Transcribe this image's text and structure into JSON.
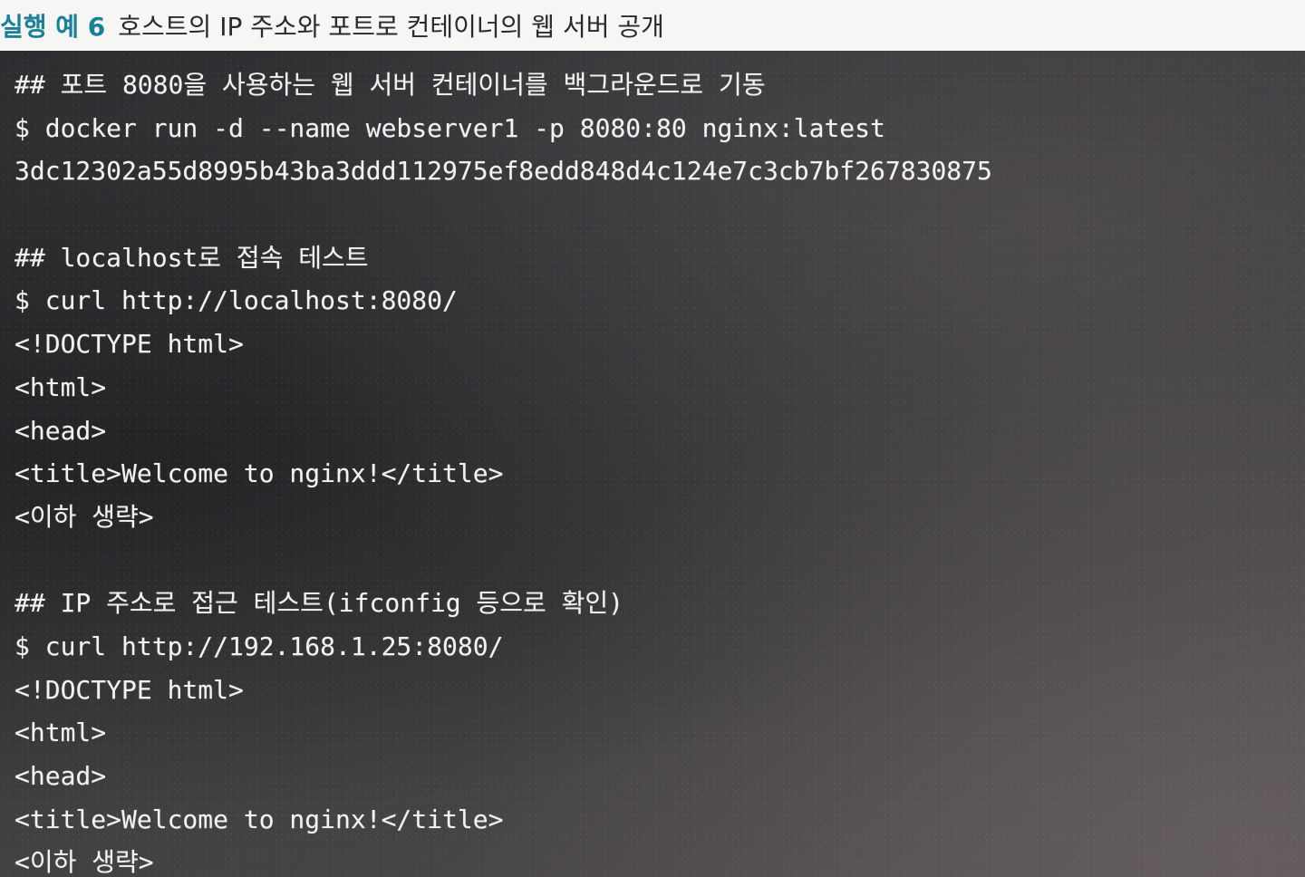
{
  "caption": {
    "label": "실행 예 6",
    "text": "호스트의 IP 주소와 포트로 컨테이너의 웹 서버 공개"
  },
  "terminal": {
    "lines": [
      "## 포트 8080을 사용하는 웹 서버 컨테이너를 백그라운드로 기동",
      "$ docker run -d --name webserver1 -p 8080:80 nginx:latest",
      "3dc12302a55d8995b43ba3ddd112975ef8edd848d4c124e7c3cb7bf267830875",
      "",
      "## localhost로 접속 테스트",
      "$ curl http://localhost:8080/",
      "<!DOCTYPE html>",
      "<html>",
      "<head>",
      "<title>Welcome to nginx!</title>",
      "<이하 생략>",
      "",
      "## IP 주소로 접근 테스트(ifconfig 등으로 확인)",
      "$ curl http://192.168.1.25:8080/",
      "<!DOCTYPE html>",
      "<html>",
      "<head>",
      "<title>Welcome to nginx!</title>",
      "<이하 생략>"
    ]
  }
}
